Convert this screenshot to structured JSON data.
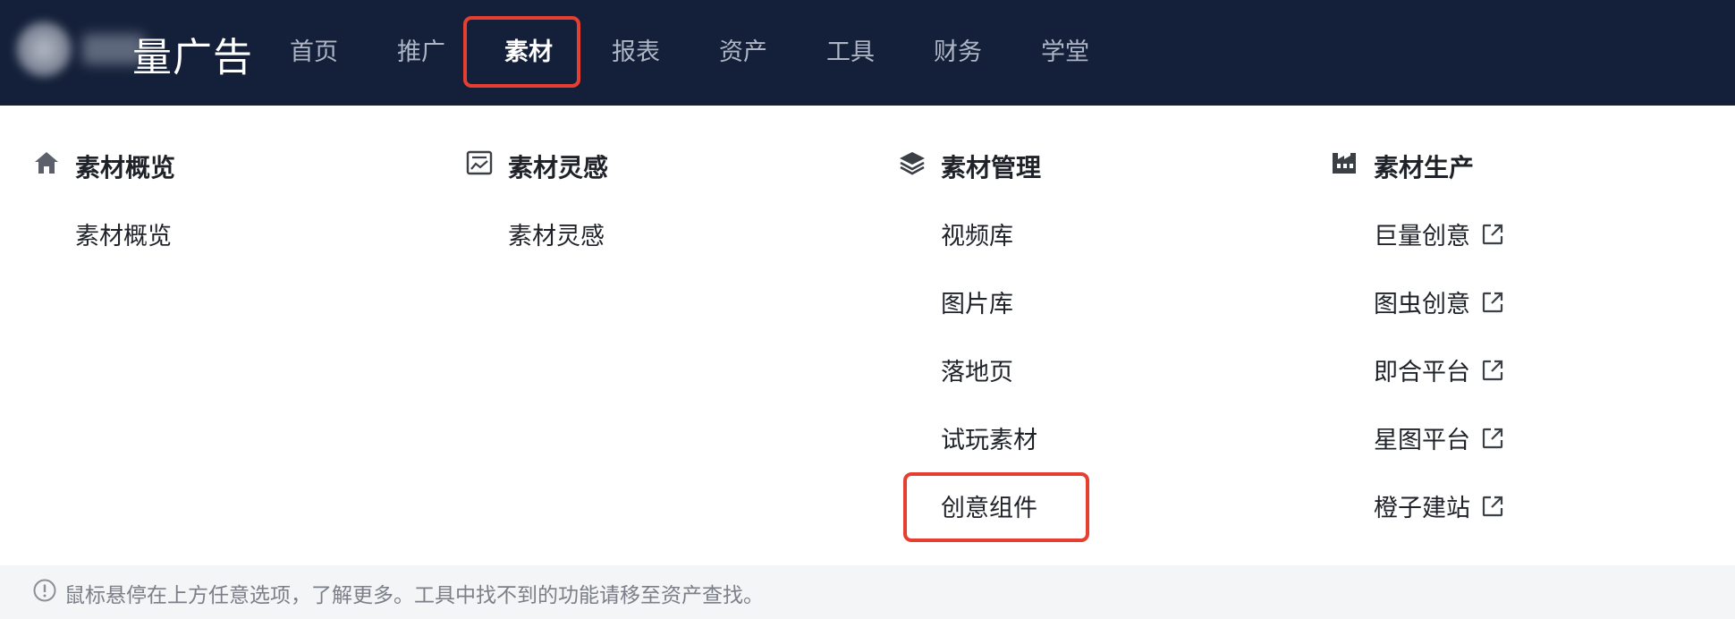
{
  "header": {
    "brand_text": "量广告",
    "nav": [
      {
        "label": "首页"
      },
      {
        "label": "推广"
      },
      {
        "label": "素材"
      },
      {
        "label": "报表"
      },
      {
        "label": "资产"
      },
      {
        "label": "工具"
      },
      {
        "label": "财务"
      },
      {
        "label": "学堂"
      }
    ],
    "active_nav": "素材"
  },
  "menu": {
    "columns": [
      {
        "title": "素材概览",
        "icon": "home-icon",
        "items": [
          {
            "label": "素材概览",
            "external": false
          }
        ]
      },
      {
        "title": "素材灵感",
        "icon": "image-chart-icon",
        "items": [
          {
            "label": "素材灵感",
            "external": false
          }
        ]
      },
      {
        "title": "素材管理",
        "icon": "layers-icon",
        "items": [
          {
            "label": "视频库",
            "external": false
          },
          {
            "label": "图片库",
            "external": false
          },
          {
            "label": "落地页",
            "external": false
          },
          {
            "label": "试玩素材",
            "external": false
          },
          {
            "label": "创意组件",
            "external": false
          }
        ]
      },
      {
        "title": "素材生产",
        "icon": "factory-icon",
        "items": [
          {
            "label": "巨量创意",
            "external": true
          },
          {
            "label": "图虫创意",
            "external": true
          },
          {
            "label": "即合平台",
            "external": true
          },
          {
            "label": "星图平台",
            "external": true
          },
          {
            "label": "橙子建站",
            "external": true
          }
        ]
      }
    ]
  },
  "footer": {
    "tip": "鼠标悬停在上方任意选项，了解更多。工具中找不到的功能请移至资产查找。",
    "icon": "info-icon"
  },
  "colors": {
    "topbar": "#142039",
    "highlight": "#e63e31",
    "nav_inactive": "#aeb6c6",
    "tip_bg": "#f4f5f7"
  }
}
